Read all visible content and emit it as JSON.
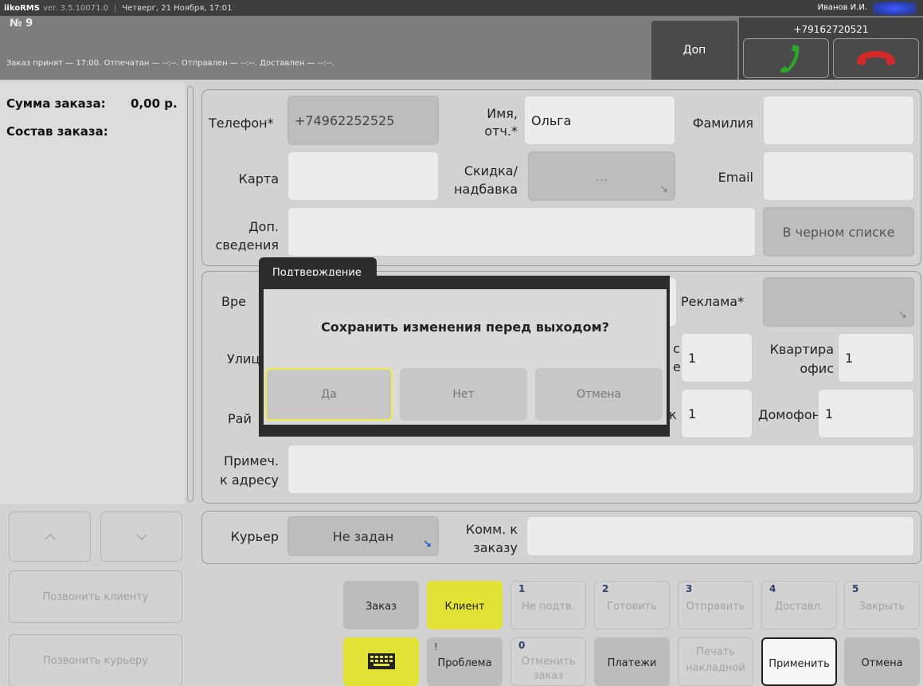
{
  "topbar": {
    "app_name": "iikoRMS",
    "version": "ver. 3.5.10071.0",
    "separator": "|",
    "datetime": "Четверг, 21 Ноября, 17:01",
    "user": "Иванов И.И."
  },
  "header": {
    "order_number": "№ 9",
    "status": "Заказ принят — 17:00. Отпечатан — --:--. Отправлен — --:--. Доставлен — --:--.",
    "extra_button": "Доп",
    "phone_number": "+79162720521"
  },
  "summary": {
    "total_label": "Сумма заказа:",
    "total_value": "0,00 р.",
    "composition_label": "Состав заказа:"
  },
  "left_buttons": {
    "call_client": "Позвонить клиенту",
    "call_courier": "Позвонить курьеру"
  },
  "client": {
    "phone_label": "Телефон*",
    "phone_value": "+74962252525",
    "name_label_1": "Имя,",
    "name_label_2": "отч.*",
    "name_value": "Ольга",
    "surname_label": "Фамилия",
    "surname_value": "",
    "card_label": "Карта",
    "card_value": "",
    "discount_label_1": "Скидка/",
    "discount_label_2": "надбавка",
    "discount_value": "...",
    "email_label": "Email",
    "email_value": "",
    "extra_label_1": "Доп.",
    "extra_label_2": "сведения",
    "extra_value": "",
    "blacklist_button": "В черном списке"
  },
  "address": {
    "time_label_partial": "Вре",
    "street_label_partial": "Улиц",
    "district_label_partial": "Рай",
    "ad_label": "Реклама*",
    "ad_value": "",
    "house_label_partial_1": "с",
    "house_label_partial_2": "е",
    "house_value": "1",
    "apartment_label_1": "Квартира",
    "apartment_label_2": "офис",
    "apartment_value": "1",
    "floor_label_partial": "к",
    "floor_value": "1",
    "intercom_label": "Домофон",
    "intercom_value": "1",
    "note_label_1": "Примеч.",
    "note_label_2": "к адресу",
    "note_value": ""
  },
  "courier": {
    "label": "Курьер",
    "value": "Не задан",
    "comment_label_1": "Комм. к",
    "comment_label_2": "заказу",
    "comment_value": ""
  },
  "bottom": {
    "order_tab": "Заказ",
    "client_tab": "Клиент",
    "steps": [
      {
        "num": "1",
        "label": "Не подтв."
      },
      {
        "num": "2",
        "label": "Готовить"
      },
      {
        "num": "3",
        "label": "Отправить"
      },
      {
        "num": "4",
        "label": "Доставл."
      },
      {
        "num": "5",
        "label": "Закрыть"
      }
    ],
    "problem_icon": "!",
    "problem": "Проблема",
    "cancel_order_num": "0",
    "cancel_order_1": "Отменить",
    "cancel_order_2": "заказ",
    "payments": "Платежи",
    "print_1": "Печать",
    "print_2": "накладной",
    "apply": "Применить",
    "cancel": "Отмена"
  },
  "dialog": {
    "title": "Подтверждение",
    "message": "Сохранить изменения перед выходом?",
    "yes": "Да",
    "no": "Нет",
    "cancel": "Отмена"
  },
  "icons": {
    "answer": "phone-answer-icon",
    "hangup": "phone-hangup-icon",
    "keyboard": "keyboard-icon",
    "up": "chevron-up-icon",
    "down": "chevron-down-icon",
    "dropdown": "corner-arrow-icon"
  },
  "colors": {
    "accent_yellow": "#e1e136",
    "answer_green": "#2aa82a",
    "hangup_red": "#d42a2a",
    "dialog_dark": "#2c2c2c",
    "link_blue": "#1b55c5"
  }
}
